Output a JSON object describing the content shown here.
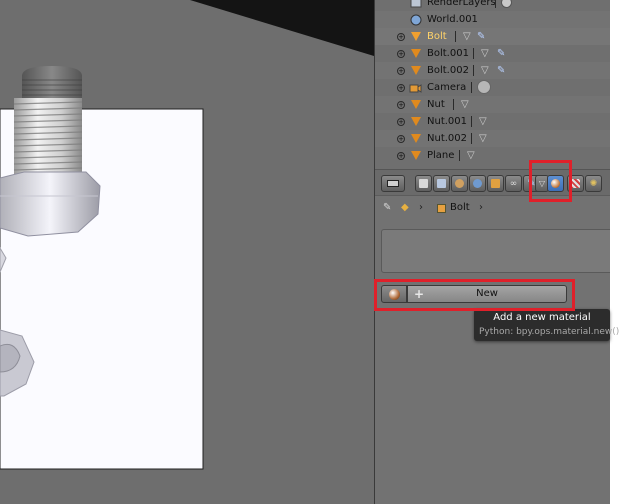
{
  "outliner": {
    "rows": [
      {
        "label": "RenderLayers",
        "icon": "render-layers-icon"
      },
      {
        "label": "World.001",
        "icon": "world-icon"
      },
      {
        "label": "Bolt",
        "icon": "mesh-icon",
        "active": true
      },
      {
        "label": "Bolt.001",
        "icon": "mesh-icon"
      },
      {
        "label": "Bolt.002",
        "icon": "mesh-icon"
      },
      {
        "label": "Camera",
        "icon": "camera-icon"
      },
      {
        "label": "Nut",
        "icon": "mesh-icon"
      },
      {
        "label": "Nut.001",
        "icon": "mesh-icon"
      },
      {
        "label": "Nut.002",
        "icon": "mesh-icon"
      },
      {
        "label": "Plane",
        "icon": "mesh-icon"
      }
    ]
  },
  "properties": {
    "active_tab": "material-tab",
    "breadcrumb": {
      "object": "Bolt",
      "separator": "›"
    },
    "new_button": {
      "label": "New",
      "plus": "+"
    }
  },
  "tooltip": {
    "title": "Add a new material",
    "python": "Python: bpy.ops.material.new()"
  },
  "colors": {
    "highlight": "#e0202a",
    "active_text": "#ffd36a",
    "accent_tab": "#4a7fc8"
  }
}
